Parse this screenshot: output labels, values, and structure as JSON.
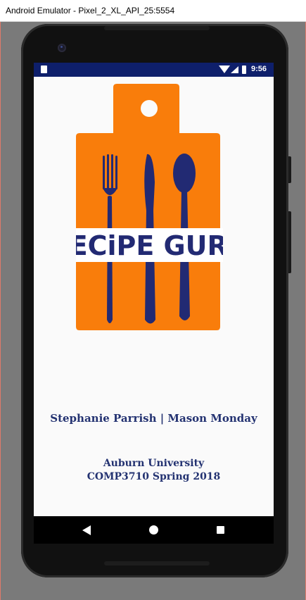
{
  "window": {
    "title": "Android Emulator - Pixel_2_XL_API_25:5554"
  },
  "status_bar": {
    "time": "9:56",
    "icons": [
      "sd-card-icon",
      "wifi-icon",
      "signal-icon",
      "battery-icon"
    ]
  },
  "logo": {
    "text": "RECiPE GURU",
    "board_color": "#f97d0b",
    "utensil_color": "#222a73"
  },
  "credits": {
    "authors": "Stephanie Parrish | Mason Monday",
    "institution": "Auburn University",
    "course": "COMP3710 Spring 2018"
  },
  "nav_bar": {
    "icons": [
      "back-icon",
      "home-icon",
      "recents-icon"
    ]
  }
}
